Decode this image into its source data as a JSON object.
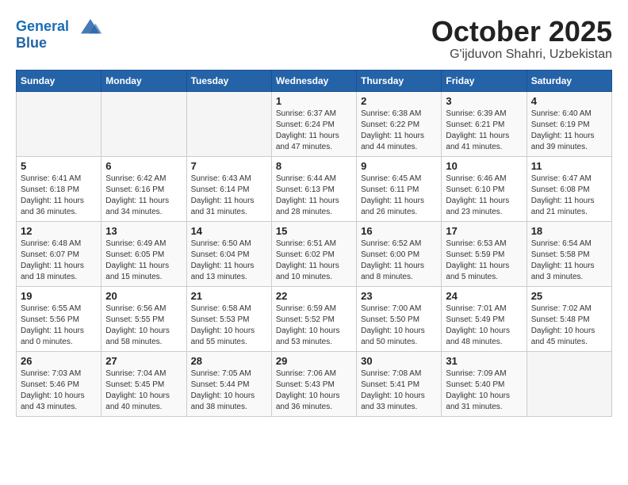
{
  "header": {
    "logo_line1": "General",
    "logo_line2": "Blue",
    "month": "October 2025",
    "location": "G'ijduvon Shahri, Uzbekistan"
  },
  "weekdays": [
    "Sunday",
    "Monday",
    "Tuesday",
    "Wednesday",
    "Thursday",
    "Friday",
    "Saturday"
  ],
  "weeks": [
    [
      {
        "day": "",
        "info": ""
      },
      {
        "day": "",
        "info": ""
      },
      {
        "day": "",
        "info": ""
      },
      {
        "day": "1",
        "info": "Sunrise: 6:37 AM\nSunset: 6:24 PM\nDaylight: 11 hours\nand 47 minutes."
      },
      {
        "day": "2",
        "info": "Sunrise: 6:38 AM\nSunset: 6:22 PM\nDaylight: 11 hours\nand 44 minutes."
      },
      {
        "day": "3",
        "info": "Sunrise: 6:39 AM\nSunset: 6:21 PM\nDaylight: 11 hours\nand 41 minutes."
      },
      {
        "day": "4",
        "info": "Sunrise: 6:40 AM\nSunset: 6:19 PM\nDaylight: 11 hours\nand 39 minutes."
      }
    ],
    [
      {
        "day": "5",
        "info": "Sunrise: 6:41 AM\nSunset: 6:18 PM\nDaylight: 11 hours\nand 36 minutes."
      },
      {
        "day": "6",
        "info": "Sunrise: 6:42 AM\nSunset: 6:16 PM\nDaylight: 11 hours\nand 34 minutes."
      },
      {
        "day": "7",
        "info": "Sunrise: 6:43 AM\nSunset: 6:14 PM\nDaylight: 11 hours\nand 31 minutes."
      },
      {
        "day": "8",
        "info": "Sunrise: 6:44 AM\nSunset: 6:13 PM\nDaylight: 11 hours\nand 28 minutes."
      },
      {
        "day": "9",
        "info": "Sunrise: 6:45 AM\nSunset: 6:11 PM\nDaylight: 11 hours\nand 26 minutes."
      },
      {
        "day": "10",
        "info": "Sunrise: 6:46 AM\nSunset: 6:10 PM\nDaylight: 11 hours\nand 23 minutes."
      },
      {
        "day": "11",
        "info": "Sunrise: 6:47 AM\nSunset: 6:08 PM\nDaylight: 11 hours\nand 21 minutes."
      }
    ],
    [
      {
        "day": "12",
        "info": "Sunrise: 6:48 AM\nSunset: 6:07 PM\nDaylight: 11 hours\nand 18 minutes."
      },
      {
        "day": "13",
        "info": "Sunrise: 6:49 AM\nSunset: 6:05 PM\nDaylight: 11 hours\nand 15 minutes."
      },
      {
        "day": "14",
        "info": "Sunrise: 6:50 AM\nSunset: 6:04 PM\nDaylight: 11 hours\nand 13 minutes."
      },
      {
        "day": "15",
        "info": "Sunrise: 6:51 AM\nSunset: 6:02 PM\nDaylight: 11 hours\nand 10 minutes."
      },
      {
        "day": "16",
        "info": "Sunrise: 6:52 AM\nSunset: 6:00 PM\nDaylight: 11 hours\nand 8 minutes."
      },
      {
        "day": "17",
        "info": "Sunrise: 6:53 AM\nSunset: 5:59 PM\nDaylight: 11 hours\nand 5 minutes."
      },
      {
        "day": "18",
        "info": "Sunrise: 6:54 AM\nSunset: 5:58 PM\nDaylight: 11 hours\nand 3 minutes."
      }
    ],
    [
      {
        "day": "19",
        "info": "Sunrise: 6:55 AM\nSunset: 5:56 PM\nDaylight: 11 hours\nand 0 minutes."
      },
      {
        "day": "20",
        "info": "Sunrise: 6:56 AM\nSunset: 5:55 PM\nDaylight: 10 hours\nand 58 minutes."
      },
      {
        "day": "21",
        "info": "Sunrise: 6:58 AM\nSunset: 5:53 PM\nDaylight: 10 hours\nand 55 minutes."
      },
      {
        "day": "22",
        "info": "Sunrise: 6:59 AM\nSunset: 5:52 PM\nDaylight: 10 hours\nand 53 minutes."
      },
      {
        "day": "23",
        "info": "Sunrise: 7:00 AM\nSunset: 5:50 PM\nDaylight: 10 hours\nand 50 minutes."
      },
      {
        "day": "24",
        "info": "Sunrise: 7:01 AM\nSunset: 5:49 PM\nDaylight: 10 hours\nand 48 minutes."
      },
      {
        "day": "25",
        "info": "Sunrise: 7:02 AM\nSunset: 5:48 PM\nDaylight: 10 hours\nand 45 minutes."
      }
    ],
    [
      {
        "day": "26",
        "info": "Sunrise: 7:03 AM\nSunset: 5:46 PM\nDaylight: 10 hours\nand 43 minutes."
      },
      {
        "day": "27",
        "info": "Sunrise: 7:04 AM\nSunset: 5:45 PM\nDaylight: 10 hours\nand 40 minutes."
      },
      {
        "day": "28",
        "info": "Sunrise: 7:05 AM\nSunset: 5:44 PM\nDaylight: 10 hours\nand 38 minutes."
      },
      {
        "day": "29",
        "info": "Sunrise: 7:06 AM\nSunset: 5:43 PM\nDaylight: 10 hours\nand 36 minutes."
      },
      {
        "day": "30",
        "info": "Sunrise: 7:08 AM\nSunset: 5:41 PM\nDaylight: 10 hours\nand 33 minutes."
      },
      {
        "day": "31",
        "info": "Sunrise: 7:09 AM\nSunset: 5:40 PM\nDaylight: 10 hours\nand 31 minutes."
      },
      {
        "day": "",
        "info": ""
      }
    ]
  ]
}
